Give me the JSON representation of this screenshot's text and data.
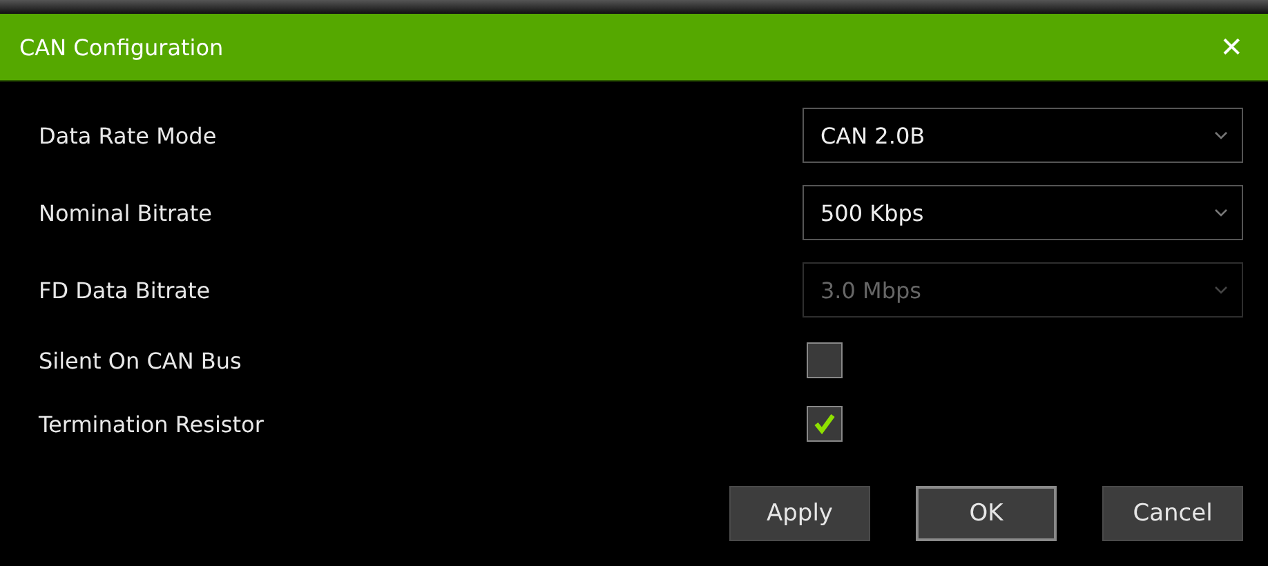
{
  "window": {
    "title": "CAN Configuration",
    "close": "✕"
  },
  "rows": [
    {
      "kind": "select",
      "label": "Data Rate Mode",
      "value": "CAN 2.0B",
      "disabled": false
    },
    {
      "kind": "select",
      "label": "Nominal Bitrate",
      "value": "500 Kbps",
      "disabled": false
    },
    {
      "kind": "select",
      "label": "FD Data Bitrate",
      "value": "3.0 Mbps",
      "disabled": true
    },
    {
      "kind": "checkbox",
      "label": "Silent On CAN Bus",
      "checked": false
    },
    {
      "kind": "checkbox",
      "label": "Termination Resistor",
      "checked": true
    }
  ],
  "buttons": [
    {
      "label": "Apply",
      "focused": false
    },
    {
      "label": "OK",
      "focused": true
    },
    {
      "label": "Cancel",
      "focused": false
    }
  ]
}
